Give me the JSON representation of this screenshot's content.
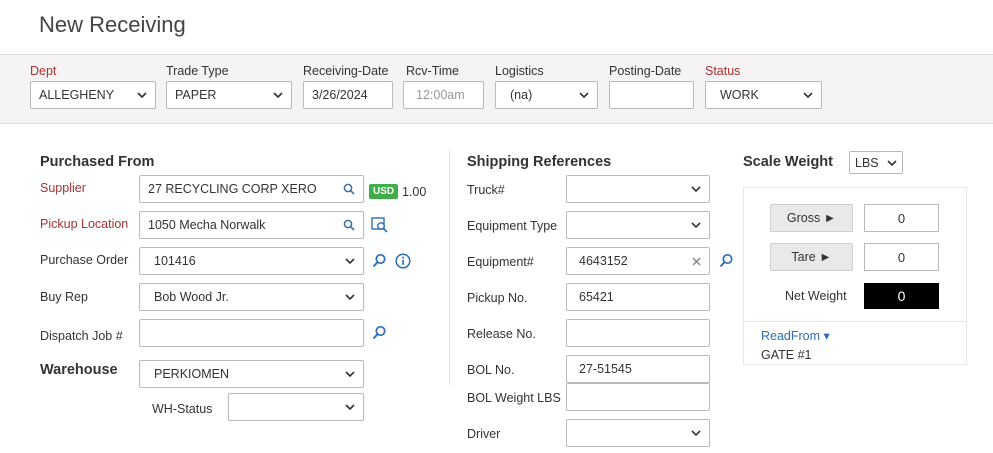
{
  "page": {
    "title": "New Receiving"
  },
  "header": {
    "dept": {
      "label": "Dept",
      "value": "ALLEGHENY"
    },
    "trade_type": {
      "label": "Trade Type",
      "value": "PAPER"
    },
    "receiving_date": {
      "label": "Receiving-Date",
      "value": "3/26/2024"
    },
    "rcv_time": {
      "label": "Rcv-Time",
      "placeholder": "12:00am"
    },
    "logistics": {
      "label": "Logistics",
      "value": "(na)"
    },
    "posting_date": {
      "label": "Posting-Date",
      "value": ""
    },
    "status": {
      "label": "Status",
      "value": "WORK"
    }
  },
  "purchased_from": {
    "heading": "Purchased From",
    "supplier": {
      "label": "Supplier",
      "value": "27 RECYCLING CORP XERO",
      "currency": "USD",
      "rate": "1.00"
    },
    "pickup_location": {
      "label": "Pickup Location",
      "value": "1050 Mecha Norwalk"
    },
    "purchase_order": {
      "label": "Purchase Order",
      "value": "101416"
    },
    "buy_rep": {
      "label": "Buy Rep",
      "value": "Bob Wood Jr."
    },
    "dispatch_job": {
      "label": "Dispatch Job #",
      "value": ""
    }
  },
  "warehouse": {
    "heading": "Warehouse",
    "value": "PERKIOMEN",
    "wh_status": {
      "label": "WH-Status",
      "value": ""
    }
  },
  "shipping": {
    "heading": "Shipping References",
    "truck": {
      "label": "Truck#",
      "value": ""
    },
    "equipment_type": {
      "label": "Equipment Type",
      "value": ""
    },
    "equipment": {
      "label": "Equipment#",
      "value": "4643152"
    },
    "pickup_no": {
      "label": "Pickup No.",
      "value": "65421"
    },
    "release_no": {
      "label": "Release No.",
      "value": ""
    },
    "bol_no": {
      "label": "BOL No.",
      "value": "27-51545"
    },
    "bol_weight": {
      "label": "BOL Weight LBS",
      "value": ""
    },
    "driver": {
      "label": "Driver",
      "value": ""
    }
  },
  "scale": {
    "heading": "Scale Weight",
    "unit": "LBS",
    "gross_label": "Gross ►",
    "gross_value": "0",
    "tare_label": "Tare ►",
    "tare_value": "0",
    "net_label": "Net Weight",
    "net_value": "0",
    "read_from_label": "ReadFrom ▾",
    "read_from_value": "GATE #1"
  },
  "colors": {
    "required_label": "#a83232",
    "usd_badge": "#3fae49",
    "link": "#2c6fb5"
  }
}
